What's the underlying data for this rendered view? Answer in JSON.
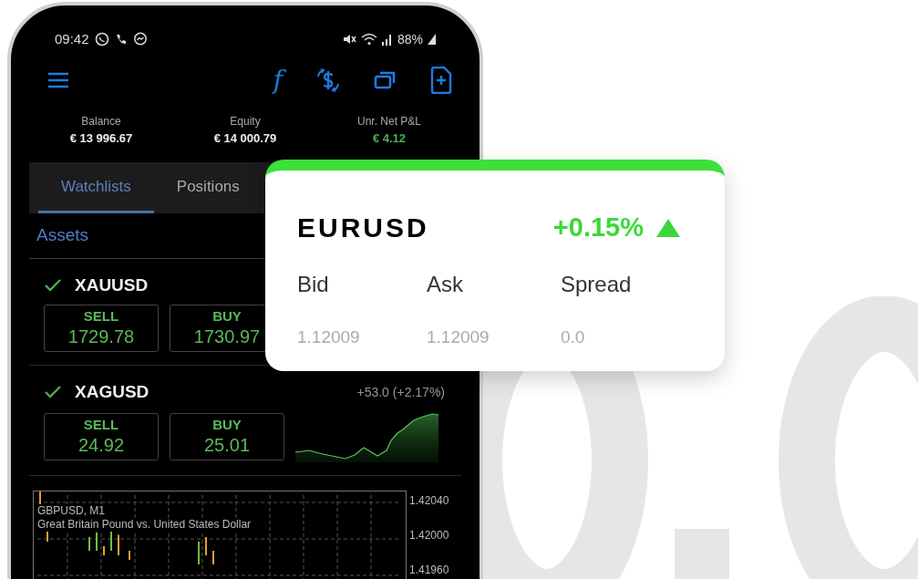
{
  "status_bar": {
    "time": "09:42",
    "battery": "88%"
  },
  "toolbar": {
    "function_glyph": "f"
  },
  "summary": [
    {
      "label": "Balance",
      "value": "€ 13 996.67",
      "positive": false
    },
    {
      "label": "Equity",
      "value": "€ 14 000.79",
      "positive": false
    },
    {
      "label": "Unr. Net P&L",
      "value": "€ 4.12",
      "positive": true
    }
  ],
  "tabs": [
    {
      "label": "Watchlists",
      "selected": true
    },
    {
      "label": "Positions",
      "selected": false
    }
  ],
  "section_title": "Assets",
  "assets": [
    {
      "symbol": "XAUUSD",
      "checked": true,
      "sell_label": "SELL",
      "sell": "1729.78",
      "buy_label": "BUY",
      "buy": "1730.97"
    },
    {
      "symbol": "XAGUSD",
      "checked": true,
      "sell_label": "SELL",
      "sell": "24.92",
      "buy_label": "BUY",
      "buy": "25.01",
      "change": "+53.0 (+2.17%)"
    }
  ],
  "price_chart": {
    "title": "GBPUSD, M1",
    "subtitle": "Great Britain Pound vs. United States Dollar",
    "price_labels": [
      "1.42040",
      "1.42000",
      "1.41960"
    ]
  },
  "quote_card": {
    "symbol": "EURUSD",
    "change": "+0.15%",
    "columns": [
      {
        "label": "Bid",
        "value": "1.12009"
      },
      {
        "label": "Ask",
        "value": "1.12009"
      },
      {
        "label": "Spread",
        "value": "0.0"
      }
    ]
  }
}
